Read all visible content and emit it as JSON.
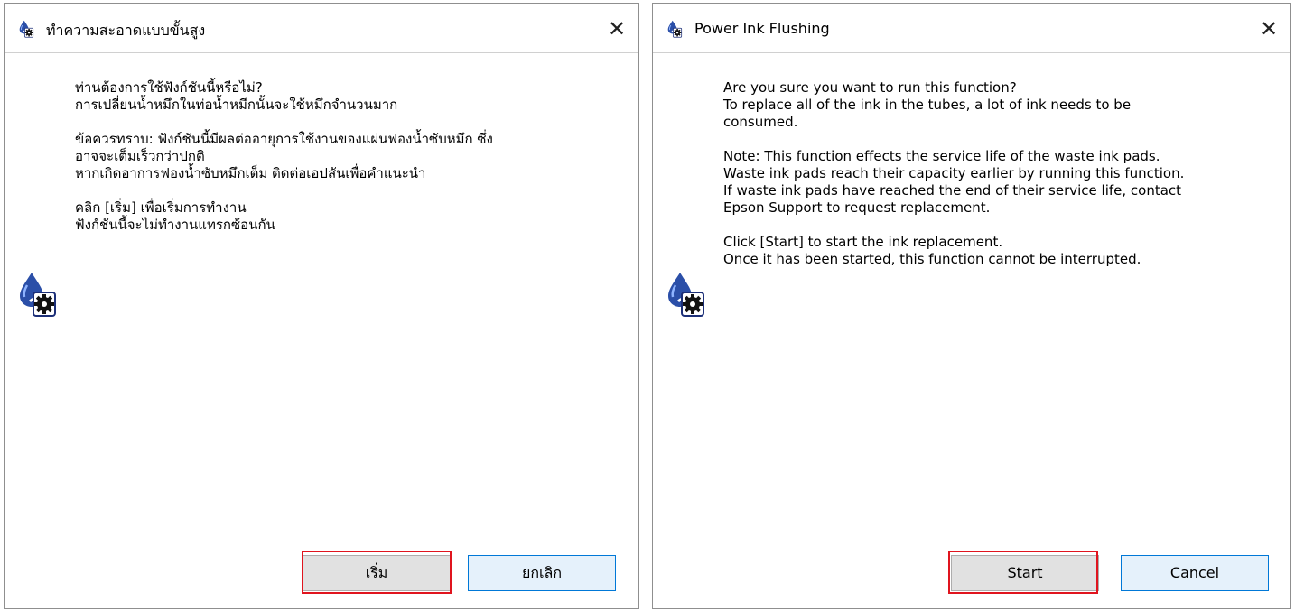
{
  "dialog_th": {
    "title": "ทำความสะอาดแบบขั้นสูง",
    "close_label": "✕",
    "paragraphs": [
      [
        "ท่านต้องการใช้ฟังก์ชันนี้หรือไม่?",
        "การเปลี่ยนน้ำหมึกในท่อน้ำหมึกนั้นจะใช้หมึกจำนวนมาก"
      ],
      [
        "ข้อควรทราบ: ฟังก์ชันนี้มีผลต่ออายุการใช้งานของแผ่นฟองน้ำซับหมึก ซึ่ง",
        "อาจจะเต็มเร็วกว่าปกติ",
        "หากเกิดอาการฟองน้ำซับหมึกเต็ม ติดต่อเอปสันเพื่อคำแนะนำ"
      ],
      [
        "คลิก [เริ่ม] เพื่อเริ่มการทำงาน",
        "ฟังก์ชันนี้จะไม่ทำงานแทรกซ้อนกัน"
      ]
    ],
    "start_label": "เริ่ม",
    "cancel_label": "ยกเลิก",
    "icon": "ink-drop-gear-icon"
  },
  "dialog_en": {
    "title": "Power Ink Flushing",
    "close_label": "✕",
    "paragraphs": [
      [
        "Are you sure you want to run this function?",
        "To replace all of the ink in the tubes, a lot of ink needs to be",
        "consumed."
      ],
      [
        "Note: This function effects the service life of the waste ink pads.",
        "Waste ink pads reach their capacity earlier by running this function.",
        "If waste ink pads have reached the end of their service life, contact",
        "Epson Support to request replacement."
      ],
      [
        "Click [Start] to start the ink replacement.",
        "Once it has been started, this function cannot be interrupted."
      ]
    ],
    "start_label": "Start",
    "cancel_label": "Cancel",
    "icon": "ink-drop-gear-icon"
  },
  "colors": {
    "highlight": "#e0141e",
    "focus_border": "#0078d7",
    "button_face": "#e1e1e1",
    "icon_blue": "#2b4fa8"
  }
}
